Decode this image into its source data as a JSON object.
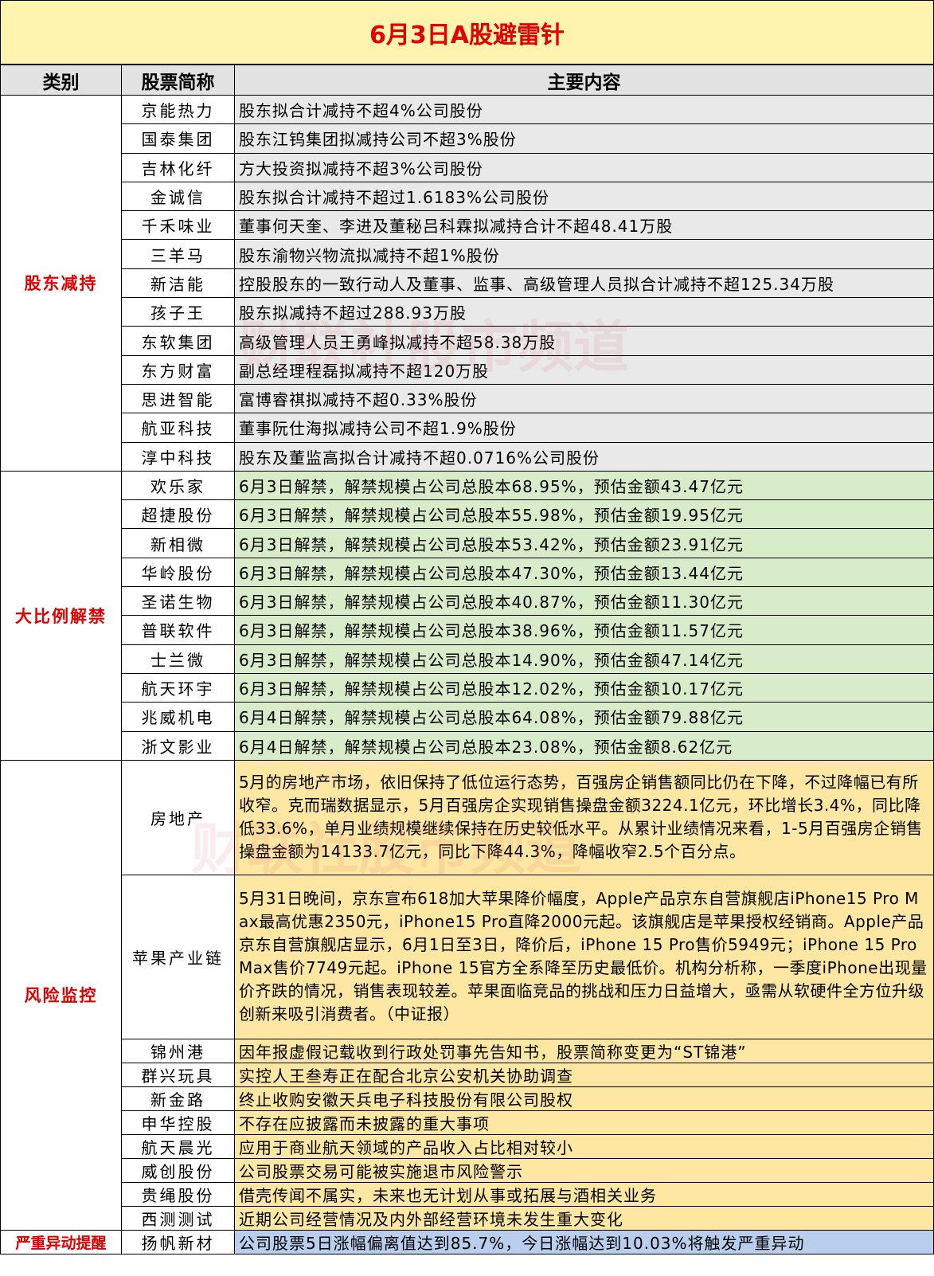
{
  "title": "6月3日A股避雷针",
  "headers": {
    "category": "类别",
    "stock": "股票简称",
    "content": "主要内容"
  },
  "groups": [
    {
      "category": "股东减持",
      "rows": [
        {
          "stock": "京能热力",
          "content": "股东拟合计减持不超4%公司股份"
        },
        {
          "stock": "国泰集团",
          "content": "股东江钨集团拟减持公司不超3%股份"
        },
        {
          "stock": "吉林化纤",
          "content": "方大投资拟减持不超3%公司股份"
        },
        {
          "stock": "金诚信",
          "content": "股东拟合计减持不超过1.6183%公司股份"
        },
        {
          "stock": "千禾味业",
          "content": "董事何天奎、李进及董秘吕科霖拟减持合计不超48.41万股"
        },
        {
          "stock": "三羊马",
          "content": "股东渝物兴物流拟减持不超1%股份"
        },
        {
          "stock": "新洁能",
          "content": "控股股东的一致行动人及董事、监事、高级管理人员拟合计减持不超125.34万股"
        },
        {
          "stock": "孩子王",
          "content": "股东拟减持不超过288.93万股"
        },
        {
          "stock": "东软集团",
          "content": "高级管理人员王勇峰拟减持不超58.38万股"
        },
        {
          "stock": "东方财富",
          "content": "副总经理程磊拟减持不超120万股"
        },
        {
          "stock": "思进智能",
          "content": "富博睿祺拟减持不超0.33%股份"
        },
        {
          "stock": "航亚科技",
          "content": "董事阮仕海拟减持公司不超1.9%股份"
        },
        {
          "stock": "淳中科技",
          "content": "股东及董监高拟合计减持不超0.0716%公司股份"
        }
      ]
    },
    {
      "category": "大比例解禁",
      "rows": [
        {
          "stock": "欢乐家",
          "content": "6月3日解禁，解禁规模占公司总股本68.95%，预估金额43.47亿元"
        },
        {
          "stock": "超捷股份",
          "content": "6月3日解禁，解禁规模占公司总股本55.98%，预估金额19.95亿元"
        },
        {
          "stock": "新相微",
          "content": "6月3日解禁，解禁规模占公司总股本53.42%，预估金额23.91亿元"
        },
        {
          "stock": "华岭股份",
          "content": "6月3日解禁，解禁规模占公司总股本47.30%，预估金额13.44亿元"
        },
        {
          "stock": "圣诺生物",
          "content": "6月3日解禁，解禁规模占公司总股本40.87%，预估金额11.30亿元"
        },
        {
          "stock": "普联软件",
          "content": "6月3日解禁，解禁规模占公司总股本38.96%，预估金额11.57亿元"
        },
        {
          "stock": "士兰微",
          "content": "6月3日解禁，解禁规模占公司总股本14.90%，预估金额47.14亿元"
        },
        {
          "stock": "航天环宇",
          "content": "6月3日解禁，解禁规模占公司总股本12.02%，预估金额10.17亿元"
        },
        {
          "stock": "兆威机电",
          "content": "6月4日解禁，解禁规模占公司总股本64.08%，预估金额79.88亿元"
        },
        {
          "stock": "浙文影业",
          "content": "6月4日解禁，解禁规模占公司总股本23.08%，预估金额8.62亿元"
        }
      ]
    },
    {
      "category": "风险监控",
      "rows": [
        {
          "stock": "房地产",
          "content": "5月的房地产市场，依旧保持了低位运行态势，百强房企销售额同比仍在下降，不过降幅已有所收窄。克而瑞数据显示，5月百强房企实现销售操盘金额3224.1亿元，环比增长3.4%，同比降低33.6%，单月业绩规模继续保持在历史较低水平。从累计业绩情况来看，1-5月百强房企销售操盘金额为14133.7亿元，同比下降44.3%，降幅收窄2.5个百分点。"
        },
        {
          "stock": "苹果产业链",
          "content": "5月31日晚间，京东宣布618加大苹果降价幅度，Apple产品京东自营旗舰店iPhone15 Pro Max最高优惠2350元，iPhone15 Pro直降2000元起。该旗舰店是苹果授权经销商。Apple产品京东自营旗舰店显示，6月1日至3日，降价后，iPhone 15 Pro售价5949元；iPhone 15 Pro Max售价7749元起。iPhone 15官方全系降至历史最低价。机构分析称，一季度iPhone出现量价齐跌的情况，销售表现较差。苹果面临竞品的挑战和压力日益增大，亟需从软硬件全方位升级创新来吸引消费者。（中证报）"
        },
        {
          "stock": "锦州港",
          "content": "因年报虚假记载收到行政处罚事先告知书，股票简称变更为“ST锦港”"
        },
        {
          "stock": "群兴玩具",
          "content": "实控人王叁寿正在配合北京公安机关协助调查"
        },
        {
          "stock": "新金路",
          "content": "终止收购安徽天兵电子科技股份有限公司股权"
        },
        {
          "stock": "申华控股",
          "content": "不存在应披露而未披露的重大事项"
        },
        {
          "stock": "航天晨光",
          "content": "应用于商业航天领域的产品收入占比相对较小"
        },
        {
          "stock": "威创股份",
          "content": "公司股票交易可能被实施退市风险警示"
        },
        {
          "stock": "贵绳股份",
          "content": "借壳传闻不属实，未来也无计划从事或拓展与酒相关业务"
        },
        {
          "stock": "西测测试",
          "content": "近期公司经营情况及内外部经营环境未发生重大变化"
        }
      ]
    },
    {
      "category": "严重异动提醒",
      "rows": [
        {
          "stock": "扬帆新材",
          "content": "公司股票5日涨幅偏离值达到85.7%，今日涨幅达到10.03%将触发严重异动"
        }
      ]
    }
  ]
}
